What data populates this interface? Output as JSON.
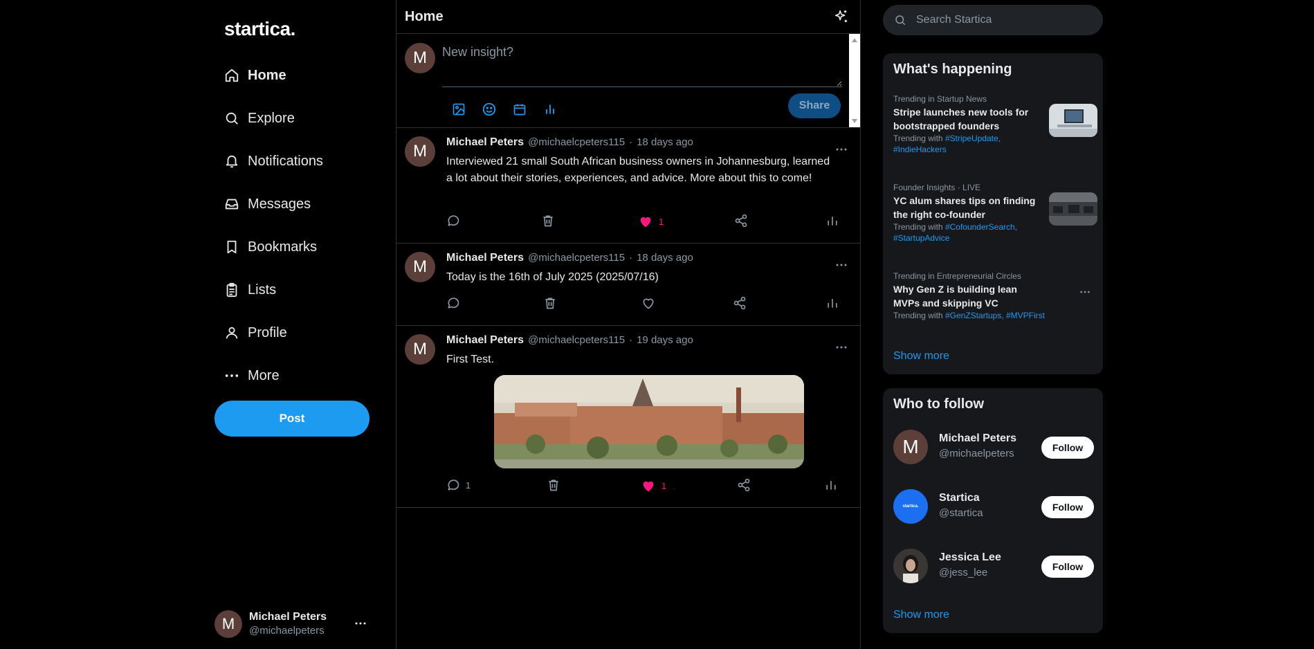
{
  "brand": {
    "logo": "startica."
  },
  "nav": {
    "items": [
      {
        "label": "Home",
        "icon": "home-icon",
        "active": true
      },
      {
        "label": "Explore",
        "icon": "search-icon"
      },
      {
        "label": "Notifications",
        "icon": "bell-icon"
      },
      {
        "label": "Messages",
        "icon": "inbox-icon"
      },
      {
        "label": "Bookmarks",
        "icon": "bookmark-icon"
      },
      {
        "label": "Lists",
        "icon": "clipboard-icon"
      },
      {
        "label": "Profile",
        "icon": "user-icon"
      },
      {
        "label": "More",
        "icon": "more-icon"
      }
    ],
    "post_button": "Post"
  },
  "current_user": {
    "initial": "M",
    "name": "Michael Peters",
    "handle": "@michaelpeters"
  },
  "main": {
    "title": "Home",
    "compose": {
      "placeholder": "New insight?",
      "share_label": "Share",
      "avatar_initial": "M"
    },
    "posts": [
      {
        "initial": "M",
        "name": "Michael Peters",
        "handle": "@michaelcpeters115",
        "dot": "·",
        "time": "18 days ago",
        "text": "Interviewed 21 small South African business owners in Johannesburg, learned a lot about their stories, experiences, and advice. More about this to come!",
        "reply_count": "",
        "like_count": "1",
        "liked": true
      },
      {
        "initial": "M",
        "name": "Michael Peters",
        "handle": "@michaelcpeters115",
        "dot": "·",
        "time": "18 days ago",
        "text": "Today is the 16th of July 2025 (2025/07/16)",
        "reply_count": "",
        "like_count": "",
        "liked": false
      },
      {
        "initial": "M",
        "name": "Michael Peters",
        "handle": "@michaelcpeters115",
        "dot": "·",
        "time": "19 days ago",
        "text": "First Test.",
        "has_image": true,
        "reply_count": "1",
        "like_count": "1",
        "liked": true
      }
    ]
  },
  "search": {
    "placeholder": "Search Startica"
  },
  "whats_happening": {
    "title": "What's happening",
    "trends": [
      {
        "category": "Trending in Startup News",
        "title": "Stripe launches new tools for bootstrapped founders",
        "prefix": "Trending with ",
        "tags": [
          "#StripeUpdate,",
          "#IndieHackers"
        ]
      },
      {
        "category": "Founder Insights · LIVE",
        "title": "YC alum shares tips on finding the right co-founder",
        "prefix": "Trending with ",
        "tags": [
          "#CofounderSearch,",
          "#StartupAdvice"
        ]
      },
      {
        "category": "Trending in Entrepreneurial Circles",
        "title": "Why Gen Z is building lean MVPs and skipping VC",
        "prefix": "Trending with ",
        "tags": [
          "#GenZStartups,",
          "#MVPFirst"
        ]
      }
    ],
    "show_more": "Show more"
  },
  "who_to_follow": {
    "title": "Who to follow",
    "people": [
      {
        "initial": "M",
        "name": "Michael Peters",
        "handle": "@michaelpeters",
        "follow_label": "Follow"
      },
      {
        "initial": "startica.",
        "name": "Startica",
        "handle": "@startica",
        "follow_label": "Follow"
      },
      {
        "initial": "",
        "name": "Jessica Lee",
        "handle": "@jess_lee",
        "follow_label": "Follow"
      }
    ],
    "show_more": "Show more"
  },
  "colors": {
    "accent": "#1d9bf0",
    "like": "#f91880",
    "panel": "#16181c",
    "border": "#2f3336"
  }
}
